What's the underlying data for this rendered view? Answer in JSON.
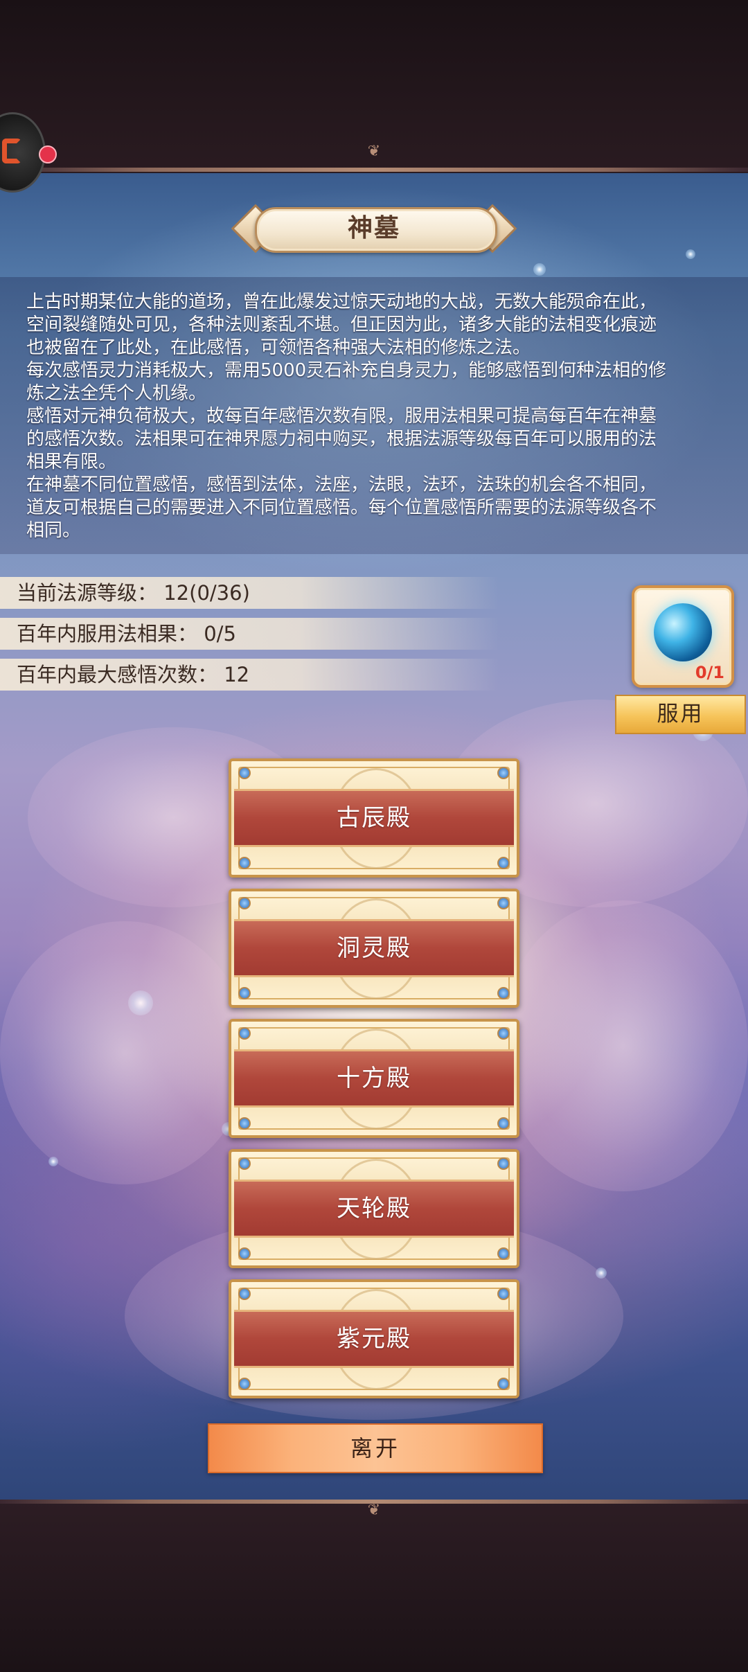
{
  "window": {
    "title": "神墓"
  },
  "description": "上古时期某位大能的道场，曾在此爆发过惊天动地的大战，无数大能殒命在此，\n空间裂缝随处可见，各种法则紊乱不堪。但正因为此，诸多大能的法相变化痕迹\n也被留在了此处，在此感悟，可领悟各种强大法相的修炼之法。\n每次感悟灵力消耗极大，需用5000灵石补充自身灵力，能够感悟到何种法相的修\n炼之法全凭个人机缘。\n感悟对元神负荷极大，故每百年感悟次数有限，服用法相果可提高每百年在神墓\n的感悟次数。法相果可在神界愿力祠中购买，根据法源等级每百年可以服用的法\n相果有限。\n在神墓不同位置感悟，感悟到法体，法座，法眼，法环，法珠的机会各不相同，\n道友可根据自己的需要进入不同位置感悟。每个位置感悟所需要的法源等级各不\n相同。",
  "stats": [
    {
      "label": "当前法源等级：",
      "value": "12(0/36)"
    },
    {
      "label": "百年内服用法相果：",
      "value": "0/5"
    },
    {
      "label": "百年内最大感悟次数：",
      "value": "12"
    }
  ],
  "item": {
    "icon": "blue-orb-icon",
    "count": "0/1",
    "use_label": "服用"
  },
  "halls": [
    {
      "label": "古辰殿"
    },
    {
      "label": "洞灵殿"
    },
    {
      "label": "十方殿"
    },
    {
      "label": "天轮殿"
    },
    {
      "label": "紫元殿"
    }
  ],
  "leave_label": "离开",
  "colors": {
    "accent": "#c8944a",
    "hall_band": "#b0473b",
    "leave_button": "#f38a4a",
    "use_button": "#f6c45a",
    "item_count": "#e23b2b"
  }
}
